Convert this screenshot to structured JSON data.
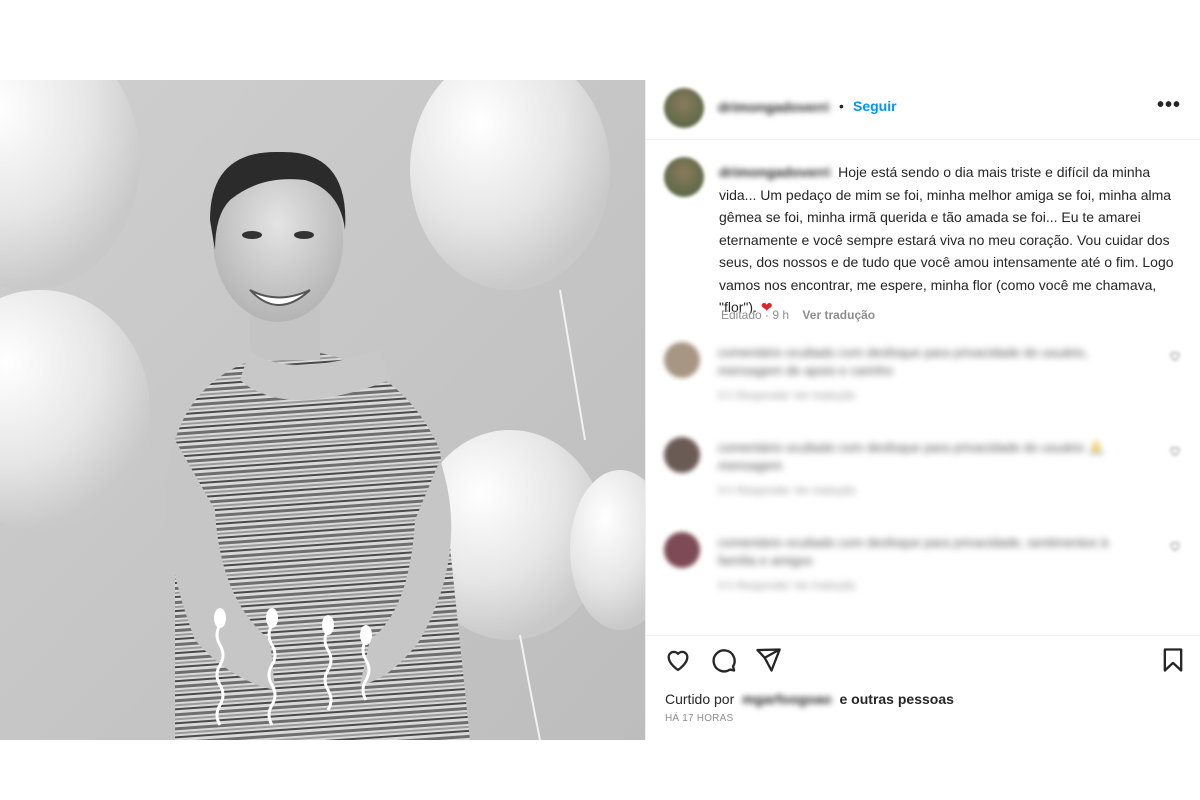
{
  "post": {
    "username": "drimongadoverri",
    "follow_label": "Seguir",
    "separator": "•",
    "more_label": "•••",
    "caption": {
      "username": "drimongadoverri",
      "text": "Hoje está sendo o dia mais triste e difícil da minha vida... Um pedaço de mim se foi, minha melhor amiga se foi, minha alma gêmea se foi, minha irmã querida e tão amada se foi... Eu te amarei eternamente e você sempre estará viva no meu coração. Vou cuidar dos seus, dos nossos e de tudo que você amou intensamente até o fim. Logo vamos nos encontrar, me espere, minha flor (como você me chamava, \"flor\").",
      "emoji": "❤",
      "edited_label": "Editado",
      "time": "9 h",
      "translate_label": "Ver tradução"
    },
    "comments": [
      {
        "text": "comentário ocultado com desfoque para privacidade do usuário, mensagem de apoio e carinho",
        "meta": "9 h   Responder   Ver tradução",
        "like_icon": "heart-outline-icon"
      },
      {
        "text": "comentário ocultado com desfoque para privacidade do usuário 🙏 mensagem",
        "meta": "9 h   Responder   Ver tradução",
        "like_icon": "heart-outline-icon"
      },
      {
        "text": "comentário ocultado com desfoque para privacidade, sentimentos à família e amigos",
        "meta": "9 h   Responder   Ver tradução",
        "like_icon": "heart-outline-icon"
      }
    ],
    "actions": {
      "like_icon": "heart-outline-icon",
      "comment_icon": "comment-bubble-icon",
      "share_icon": "paper-plane-icon",
      "save_icon": "bookmark-icon"
    },
    "likes": {
      "prefix": "Curtido por",
      "user": "mgarfoogoao",
      "suffix": "e outras pessoas"
    },
    "timestamp": "HÁ 17 HORAS"
  },
  "colors": {
    "accent": "#0095f6",
    "heart": "#e0242b",
    "text": "#262626",
    "muted": "#8e8e8e"
  }
}
